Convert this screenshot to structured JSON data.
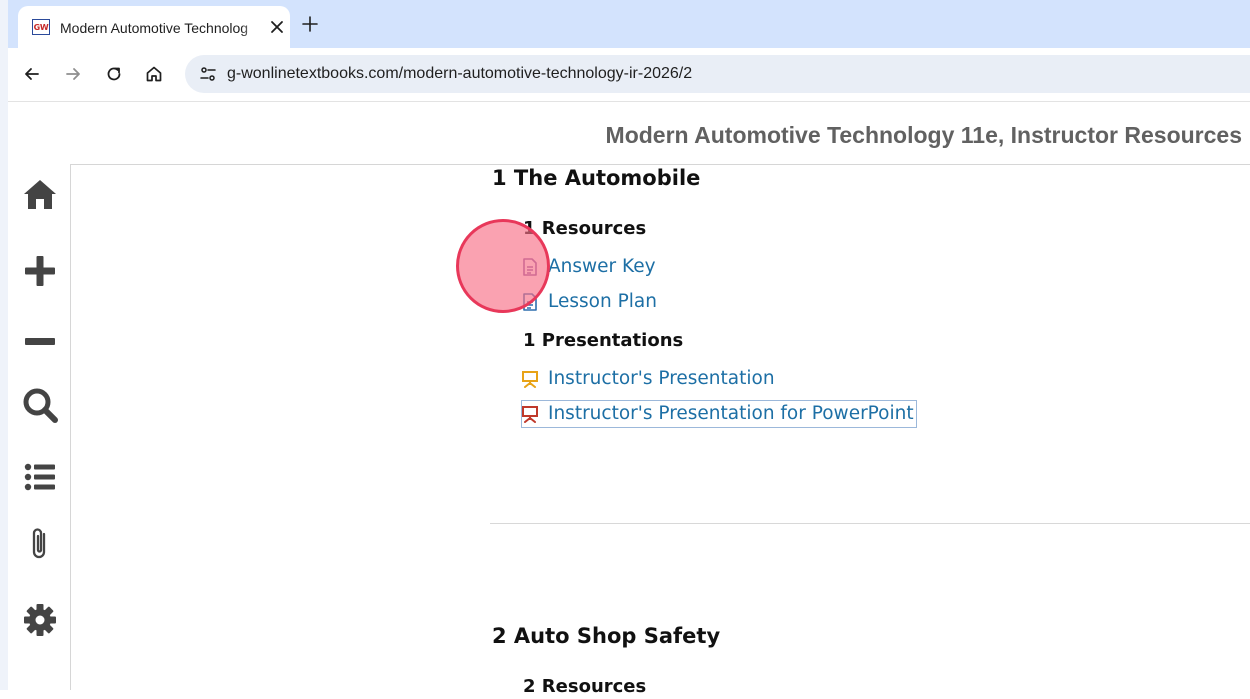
{
  "browser": {
    "tab": {
      "title": "Modern Automotive Technolog",
      "favicon_text": "GW",
      "close_icon": "close-icon"
    },
    "new_tab_icon": "plus-icon",
    "nav": {
      "back_icon": "arrow-left-icon",
      "forward_icon": "arrow-right-icon",
      "reload_icon": "reload-icon",
      "home_icon": "home-icon"
    },
    "address_bar": {
      "site_info_icon": "tune-icon",
      "url": "g-wonlinetextbooks.com/modern-automotive-technology-ir-2026/2"
    }
  },
  "page": {
    "title": "Modern Automotive Technology 11e, Instructor Resources",
    "sidebar_icons": [
      "home-icon",
      "zoom-in-icon",
      "zoom-out-icon",
      "search-icon",
      "list-icon",
      "paperclip-icon",
      "gear-icon"
    ],
    "chapters": [
      {
        "title": "1 The Automobile",
        "sections": [
          {
            "heading": "1 Resources",
            "items": [
              {
                "label": "Answer Key",
                "icon": "document-icon"
              },
              {
                "label": "Lesson Plan",
                "icon": "document-icon"
              }
            ]
          },
          {
            "heading": "1 Presentations",
            "items": [
              {
                "label": "Instructor's Presentation",
                "icon": "presentation-icon"
              },
              {
                "label": "Instructor's Presentation for PowerPoint",
                "icon": "presentation-icon"
              }
            ]
          }
        ]
      },
      {
        "title": "2 Auto Shop Safety",
        "sections": [
          {
            "heading": "2 Resources",
            "items": []
          }
        ]
      }
    ]
  },
  "colors": {
    "link": "#1d6fa5",
    "tabstrip": "#d3e3fd",
    "click_marker": "#e8385a",
    "presentation_icon_orange": "#e8a317",
    "presentation_icon_red": "#c0392b",
    "document_icon_purple": "#8a5fa8",
    "document_icon_blue": "#2f6fae"
  }
}
